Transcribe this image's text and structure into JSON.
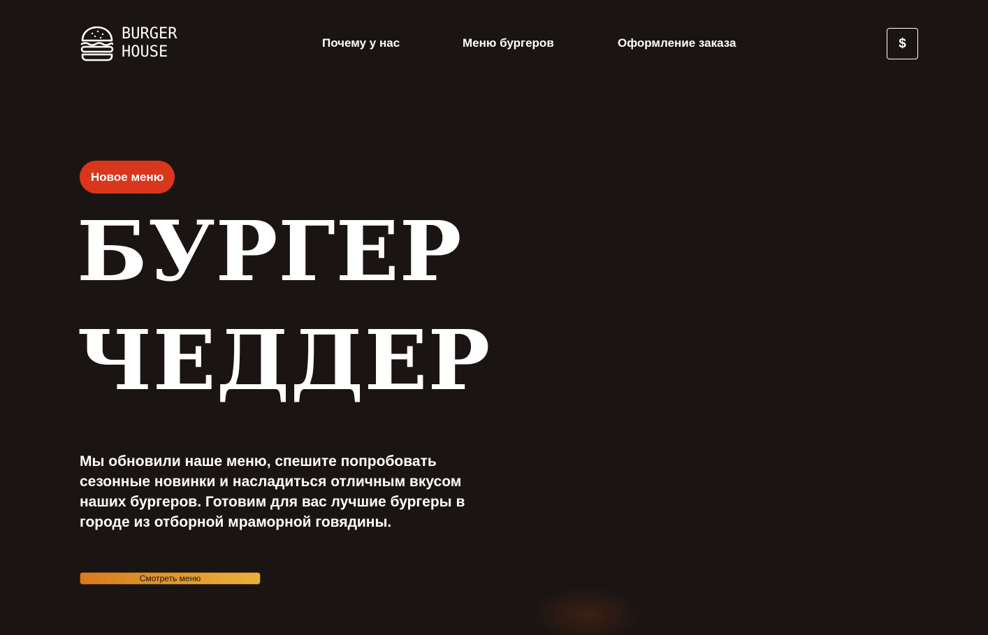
{
  "header": {
    "logo": {
      "line1": "BURGER",
      "line2": "HOUSE",
      "icon": "burger-icon"
    },
    "nav": [
      {
        "label": "Почему у нас"
      },
      {
        "label": "Меню бургеров"
      },
      {
        "label": "Оформление заказа"
      }
    ],
    "currency_button": {
      "label": "$"
    }
  },
  "hero": {
    "badge": "Новое меню",
    "title_line1": "БУРГЕР",
    "title_line2": "ЧЕДДЕР",
    "description": "Мы обновили наше меню, спешите попробовать сезонные новинки и насладиться отличным вкусом наших бургеров. Готовим для вас лучшие бургеры в городе из отборной мраморной говядины.",
    "cta_label": "Смотреть меню"
  },
  "colors": {
    "background": "#1a1513",
    "badge": "#d9361b",
    "cta_gradient_start": "#d97a1e",
    "cta_gradient_end": "#e9b23a",
    "text": "#ffffff"
  }
}
